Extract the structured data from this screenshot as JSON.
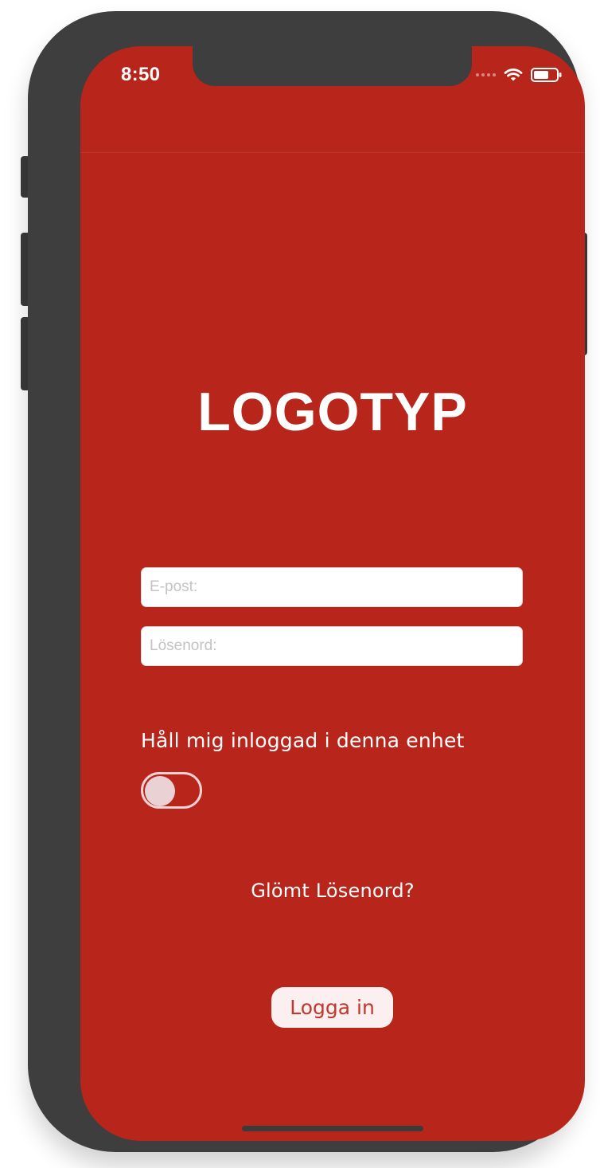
{
  "status_bar": {
    "time": "8:50"
  },
  "app": {
    "logo_text": "LOGOTYP"
  },
  "login_form": {
    "email_placeholder": "E-post:",
    "password_placeholder": "Lösenord:",
    "remember_label": "Håll mig inloggad i denna enhet",
    "forgot_password": "Glömt Lösenord?",
    "login_button": "Logga in"
  },
  "colors": {
    "accent": "#b8251a",
    "button_background": "#fbefef",
    "button_text": "#c1372d"
  }
}
